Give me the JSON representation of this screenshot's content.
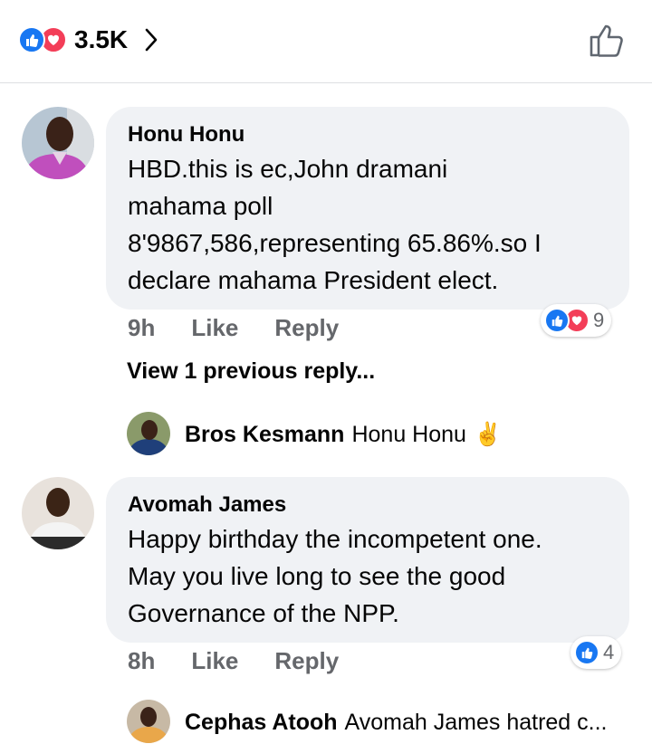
{
  "header": {
    "reaction_count": "3.5K",
    "reaction_icons": [
      "like-icon",
      "love-icon"
    ]
  },
  "comments": [
    {
      "author": "Honu Honu",
      "lines": [
        "HBD.this is ec,John dramani",
        "mahama poll",
        "8'9867,586,representing 65.86%.so I",
        "declare mahama President elect."
      ],
      "time": "9h",
      "like_label": "Like",
      "reply_label": "Reply",
      "reaction_count": "9",
      "reaction_icons": [
        "like-icon",
        "love-icon"
      ]
    },
    {
      "author": "Avomah James",
      "lines": [
        "Happy birthday the incompetent one.",
        "May you live long to see the good",
        "Governance of the NPP."
      ],
      "time": "8h",
      "like_label": "Like",
      "reply_label": "Reply",
      "reaction_count": "4",
      "reaction_icons": [
        "like-icon"
      ]
    }
  ],
  "view_previous_replies": "View 1 previous reply...",
  "replies": [
    {
      "author": "Bros Kesmann",
      "text": "Honu Honu",
      "emoji": "✌️"
    },
    {
      "author": "Cephas Atooh",
      "text": "Avomah James hatred c..."
    }
  ],
  "colors": {
    "like_blue": "#1877f2",
    "love_red": "#f33e58",
    "bubble_bg": "#f0f2f5",
    "meta_gray": "#65676b"
  }
}
